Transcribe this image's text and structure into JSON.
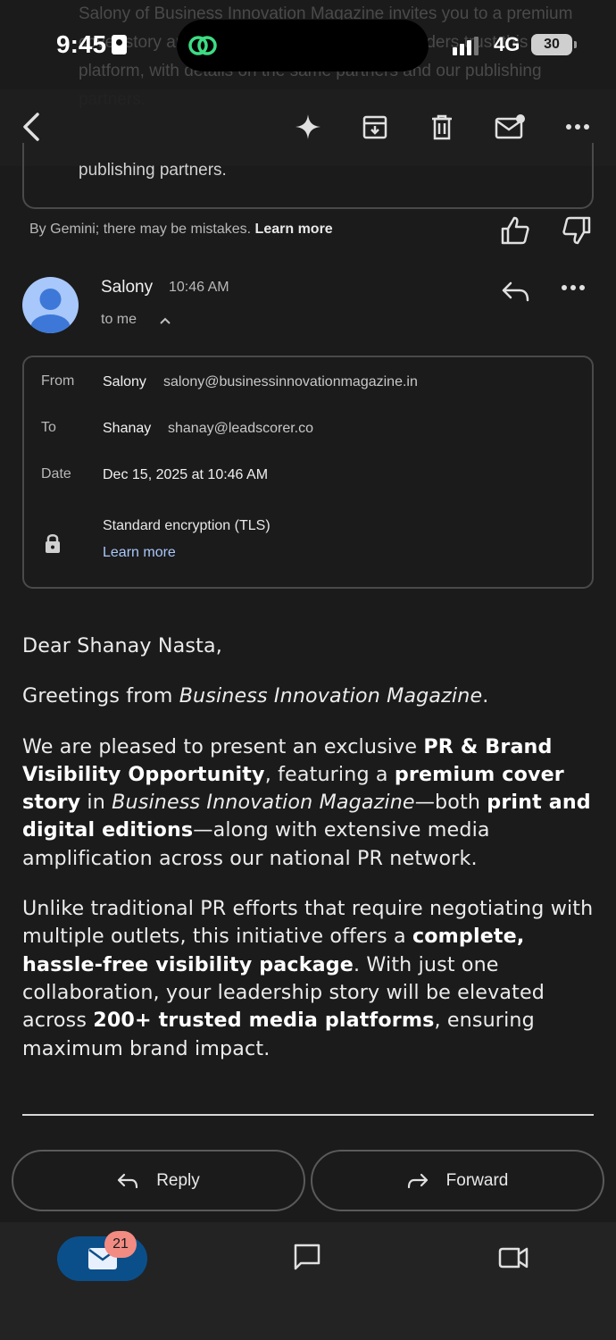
{
  "status_bar": {
    "time": "9:45",
    "network": "4G",
    "battery": "30"
  },
  "background_text": "Salony of Business Innovation Magazine invites you to a premium cover story amplification opportunity. Many leaders trust this platform, with details on the same partners and our publishing partners.",
  "toolbar": {
    "back_icon": "back-arrow-icon",
    "gemini_icon": "sparkle-icon",
    "archive_icon": "archive-icon",
    "delete_icon": "trash-icon",
    "mark_unread_icon": "mail-unread-icon",
    "more_icon": "more-horizontal-icon"
  },
  "summary": {
    "tail_text": "publishing partners.",
    "note": "By Gemini; there may be mistakes.",
    "learn_more": "Learn more"
  },
  "message": {
    "sender": "Salony",
    "time": "10:46 AM",
    "recipient_summary": "to me"
  },
  "details": {
    "from_label": "From",
    "from_name": "Salony",
    "from_email": "salony@businessinnovationmagazine.in",
    "to_label": "To",
    "to_name": "Shanay",
    "to_email": "shanay@leadscorer.co",
    "date_label": "Date",
    "date_value": "Dec 15, 2025 at 10:46 AM",
    "encryption": "Standard encryption (TLS)",
    "learn_more": "Learn more"
  },
  "body": {
    "greeting": "Dear Shanay Nasta,",
    "p1_a": "Greetings from ",
    "p1_mag": "Business Innovation Magazine",
    "p1_b": ".",
    "p2_a": "We are pleased to present an exclusive ",
    "p2_b": "PR & Brand Visibility Opportunity",
    "p2_c": ", featuring a ",
    "p2_d": "premium cover story",
    "p2_e": " in ",
    "p2_mag": "Business Innovation Magazine",
    "p2_f": "—both ",
    "p2_g": "print and digital editions",
    "p2_h": "—along with extensive media amplification across our national PR network.",
    "p3_a": "Unlike traditional PR efforts that require negotiating with multiple outlets, this initiative offers a ",
    "p3_b": "complete, hassle-free visibility package",
    "p3_c": ". With just one collaboration, your leadership story will be elevated across ",
    "p3_d": "200+ trusted media platforms",
    "p3_e": ", ensuring maximum brand impact."
  },
  "actions": {
    "reply": "Reply",
    "forward": "Forward"
  },
  "bottom_nav": {
    "mail_badge": "21"
  },
  "colors": {
    "background": "#1b1b1b",
    "link": "#a8c7fa",
    "mail_pill": "#0b4f8a",
    "badge": "#f28b82"
  }
}
